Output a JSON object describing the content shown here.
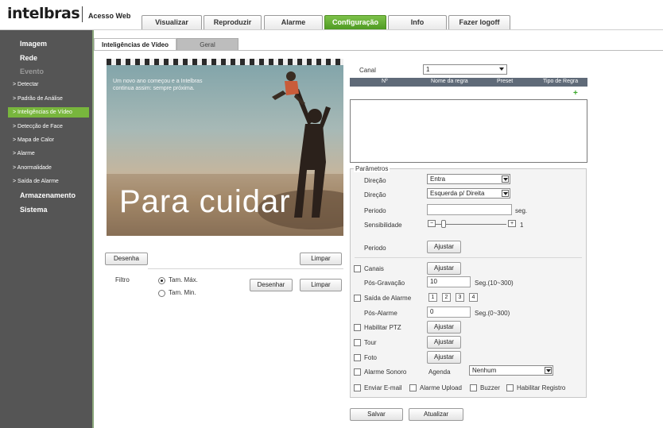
{
  "header": {
    "logo": "intelbras",
    "app_title": "Acesso Web",
    "tabs": [
      "Visualizar",
      "Reproduzir",
      "Alarme",
      "Configuração",
      "Info",
      "Fazer logoff"
    ],
    "active_tab": "Configuração",
    "accent_color": "#6aae33"
  },
  "sidebar": {
    "items": [
      {
        "label": "Imagem",
        "level": 1
      },
      {
        "label": "Rede",
        "level": 1
      },
      {
        "label": "Evento",
        "level": 1
      },
      {
        "label": "> Detectar",
        "level": 2
      },
      {
        "label": "> Padrão de Análise",
        "level": 2
      },
      {
        "label": "> Inteligências de Vídeo",
        "level": 2,
        "active": true
      },
      {
        "label": "> Detecção de Face",
        "level": 2
      },
      {
        "label": "> Mapa de Calor",
        "level": 2
      },
      {
        "label": "> Alarme",
        "level": 2
      },
      {
        "label": "> Anormalidade",
        "level": 2
      },
      {
        "label": "> Saída de Alarme",
        "level": 2
      },
      {
        "label": "Armazenamento",
        "level": 1
      },
      {
        "label": "Sistema",
        "level": 1
      }
    ]
  },
  "content_tabs": [
    "Inteligências de Vídeo",
    "Geral"
  ],
  "video": {
    "caption_line1": "Um novo ano começou e a Intelbras",
    "caption_line2": "continua assim: sempre próxima.",
    "big_text": "Para cuidar"
  },
  "left_controls": {
    "draw_button": "Desenha",
    "clear_button": "Limpar",
    "filter_label": "Filtro",
    "radio_max": "Tam. Máx.",
    "radio_min": "Tam. Min.",
    "draw_button2": "Desenhar",
    "clear_button2": "Limpar"
  },
  "rules": {
    "channel_label": "Canal",
    "channel_value": "1",
    "columns": [
      "Nº",
      "Nome da regra",
      "Preset",
      "Tipo de Regra"
    ]
  },
  "params": {
    "legend": "Parâmetros",
    "direction_label": "Direção",
    "direction_value": "Entra",
    "direction2_label": "Direção",
    "direction2_value": "Esquerda p/ Direita",
    "period_label": "Periodo",
    "period_unit": "seg.",
    "sensitivity_label": "Sensibilidade",
    "sensitivity_value": "1",
    "sensitivity_fraction": 0.05,
    "period2_label": "Periodo",
    "adjust_label": "Ajustar",
    "channels_label": "Canais",
    "post_record_label": "Pós-Gravação",
    "post_record_value": "10",
    "post_record_range": "Seg.(10~300)",
    "alarm_output_label": "Saída de Alarme",
    "alarm_outputs": [
      "1",
      "2",
      "3",
      "4"
    ],
    "post_alarm_label": "Pós-Alarme",
    "post_alarm_value": "0",
    "post_alarm_range": "Seg.(0~300)",
    "ptz_label": "Habilitar PTZ",
    "tour_label": "Tour",
    "photo_label": "Foto",
    "alarm_sound_label": "Alarme Sonoro",
    "schedule_label": "Agenda",
    "schedule_value": "Nenhum",
    "email_label": "Enviar E-mail",
    "alarm_upload_label": "Alarme Upload",
    "buzzer_label": "Buzzer",
    "log_label": "Habilitar Registro"
  },
  "footer": {
    "save_label": "Salvar",
    "refresh_label": "Atualizar"
  }
}
